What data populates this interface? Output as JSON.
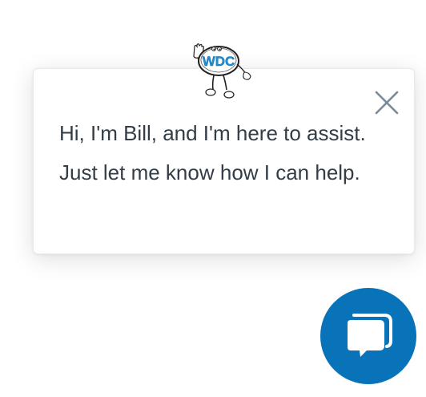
{
  "popup": {
    "message": "Hi, I'm Bill, and I'm here to assist. Just let me know how I can help."
  },
  "mascot": {
    "logo_text": "WDC"
  },
  "colors": {
    "accent": "#0873b9",
    "text": "#333d47",
    "close_icon": "#7a8a99",
    "logo_blue": "#1e90d6"
  },
  "icons": {
    "close": "close-icon",
    "chat": "chat-bubbles-icon"
  }
}
